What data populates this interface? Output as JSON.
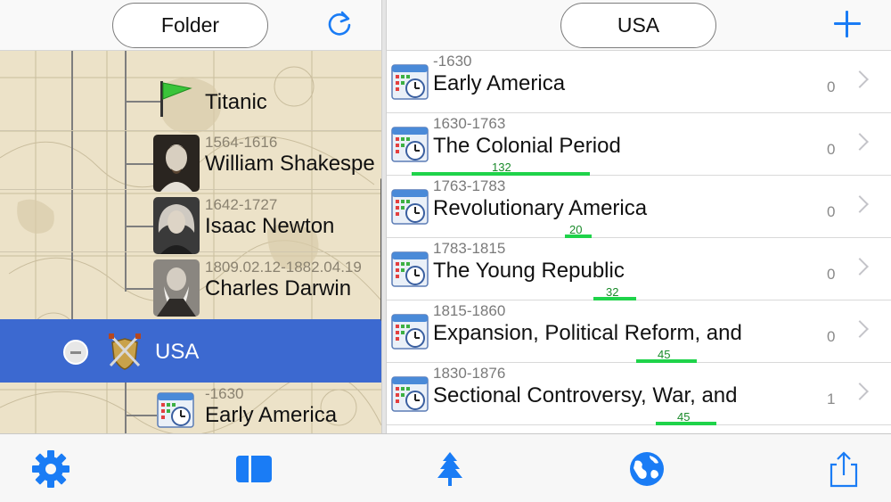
{
  "left_header": {
    "folder_label": "Folder",
    "refresh_icon": "refresh-icon"
  },
  "tree": {
    "items": [
      {
        "name": "Titanic",
        "date": "",
        "icon": "green-flag-icon"
      },
      {
        "name": "William Shakespe",
        "date": "1564-1616",
        "icon": "shakespeare-portrait"
      },
      {
        "name": "Isaac Newton",
        "date": "1642-1727",
        "icon": "newton-portrait"
      },
      {
        "name": "Charles Darwin",
        "date": "1809.02.12-1882.04.19",
        "icon": "darwin-portrait"
      }
    ],
    "selected": {
      "name": "USA",
      "icon": "crossed-swords-shield-icon"
    },
    "children": [
      {
        "name": "Early America",
        "date": "-1630",
        "icon": "calendar-clock-icon"
      }
    ]
  },
  "right_header": {
    "folder_label": "USA",
    "add_icon": "plus-icon"
  },
  "periods": [
    {
      "date": "-1630",
      "title": "Early America",
      "count": "0",
      "bar_value": ""
    },
    {
      "date": "1630-1763",
      "title": "The Colonial Period",
      "count": "0",
      "bar_value": "132"
    },
    {
      "date": "1763-1783",
      "title": "Revolutionary America",
      "count": "0",
      "bar_value": "20"
    },
    {
      "date": "1783-1815",
      "title": "The Young Republic",
      "count": "0",
      "bar_value": "32"
    },
    {
      "date": "1815-1860",
      "title": "Expansion, Political Reform, and",
      "count": "0",
      "bar_value": "45"
    },
    {
      "date": "1830-1876",
      "title": "Sectional Controversy, War, and",
      "count": "1",
      "bar_value": "45"
    }
  ],
  "tab_bar": {
    "tabs": [
      {
        "icon": "gear-icon"
      },
      {
        "icon": "split-view-icon"
      },
      {
        "icon": "tree-icon"
      },
      {
        "icon": "globe-icon"
      },
      {
        "icon": "share-icon"
      }
    ]
  },
  "colors": {
    "accent": "#1a7cf5",
    "selection": "#3c69d0",
    "bar": "#1fd34a",
    "parchment": "#ede4cc"
  }
}
